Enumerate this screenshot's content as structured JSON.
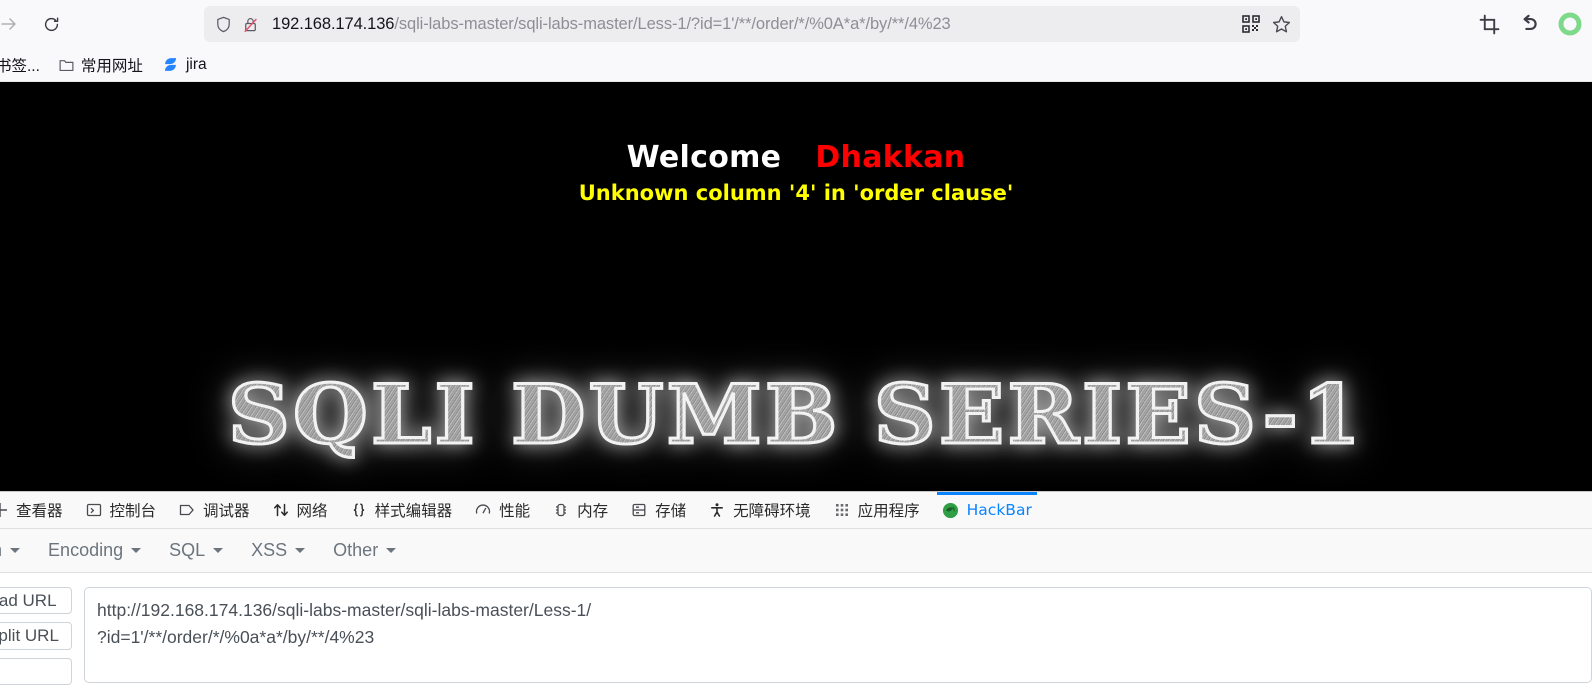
{
  "browser": {
    "url_host": "192.168.174.136",
    "url_path": "/sqli-labs-master/sqli-labs-master/Less-1/?id=1'/**/order/*/%0A*a*/by/**/4%23",
    "nav": {
      "forward_label": "forward-arrow",
      "reload_label": "reload"
    },
    "urlbar_icons": {
      "shield": "shield-icon",
      "lock_insecure": "lock-crossed-icon",
      "qr": "qr-code-icon",
      "bookmark_star": "star-icon"
    },
    "toolbar_right": {
      "screenshot": "crop-icon",
      "undo": "undo-arrow-icon",
      "extension": "green-circle-icon"
    }
  },
  "bookmarks": {
    "items": [
      {
        "label": "书签...",
        "icon": "bookmark-folder-icon"
      },
      {
        "label": "常用网址",
        "icon": "folder-icon"
      },
      {
        "label": "jira",
        "icon": "jira-icon"
      }
    ]
  },
  "page": {
    "welcome": "Welcome",
    "name": "Dhakkan",
    "error": "Unknown column '4' in 'order clause'",
    "banner": "SQLI DUMB SERIES-1"
  },
  "devtools": {
    "tabs": [
      {
        "label": "查看器",
        "icon": "inspector-icon",
        "active": false
      },
      {
        "label": "控制台",
        "icon": "console-icon",
        "active": false
      },
      {
        "label": "调试器",
        "icon": "debugger-icon",
        "active": false
      },
      {
        "label": "网络",
        "icon": "network-icon",
        "active": false
      },
      {
        "label": "样式编辑器",
        "icon": "style-editor-icon",
        "active": false
      },
      {
        "label": "性能",
        "icon": "performance-icon",
        "active": false
      },
      {
        "label": "内存",
        "icon": "memory-icon",
        "active": false
      },
      {
        "label": "存储",
        "icon": "storage-icon",
        "active": false
      },
      {
        "label": "无障碍环境",
        "icon": "accessibility-icon",
        "active": false
      },
      {
        "label": "应用程序",
        "icon": "application-icon",
        "active": false
      },
      {
        "label": "HackBar",
        "icon": "hackbar-icon",
        "active": true
      }
    ]
  },
  "hackbar": {
    "menu": [
      {
        "label": "yption"
      },
      {
        "label": "Encoding"
      },
      {
        "label": "SQL"
      },
      {
        "label": "XSS"
      },
      {
        "label": "Other"
      }
    ],
    "buttons": [
      {
        "label": "oad URL"
      },
      {
        "label": "Split URL"
      },
      {
        "label": ""
      }
    ],
    "url_value": "http://192.168.174.136/sqli-labs-master/sqli-labs-master/Less-1/\n?id=1'/**/order/*/%0a*a*/by/**/4%23",
    "url_placeholder": "URL"
  },
  "colors": {
    "accent_blue": "#0a84ff",
    "error_yellow": "#ffff00",
    "name_red": "#ff0000",
    "page_bg": "#000000"
  }
}
